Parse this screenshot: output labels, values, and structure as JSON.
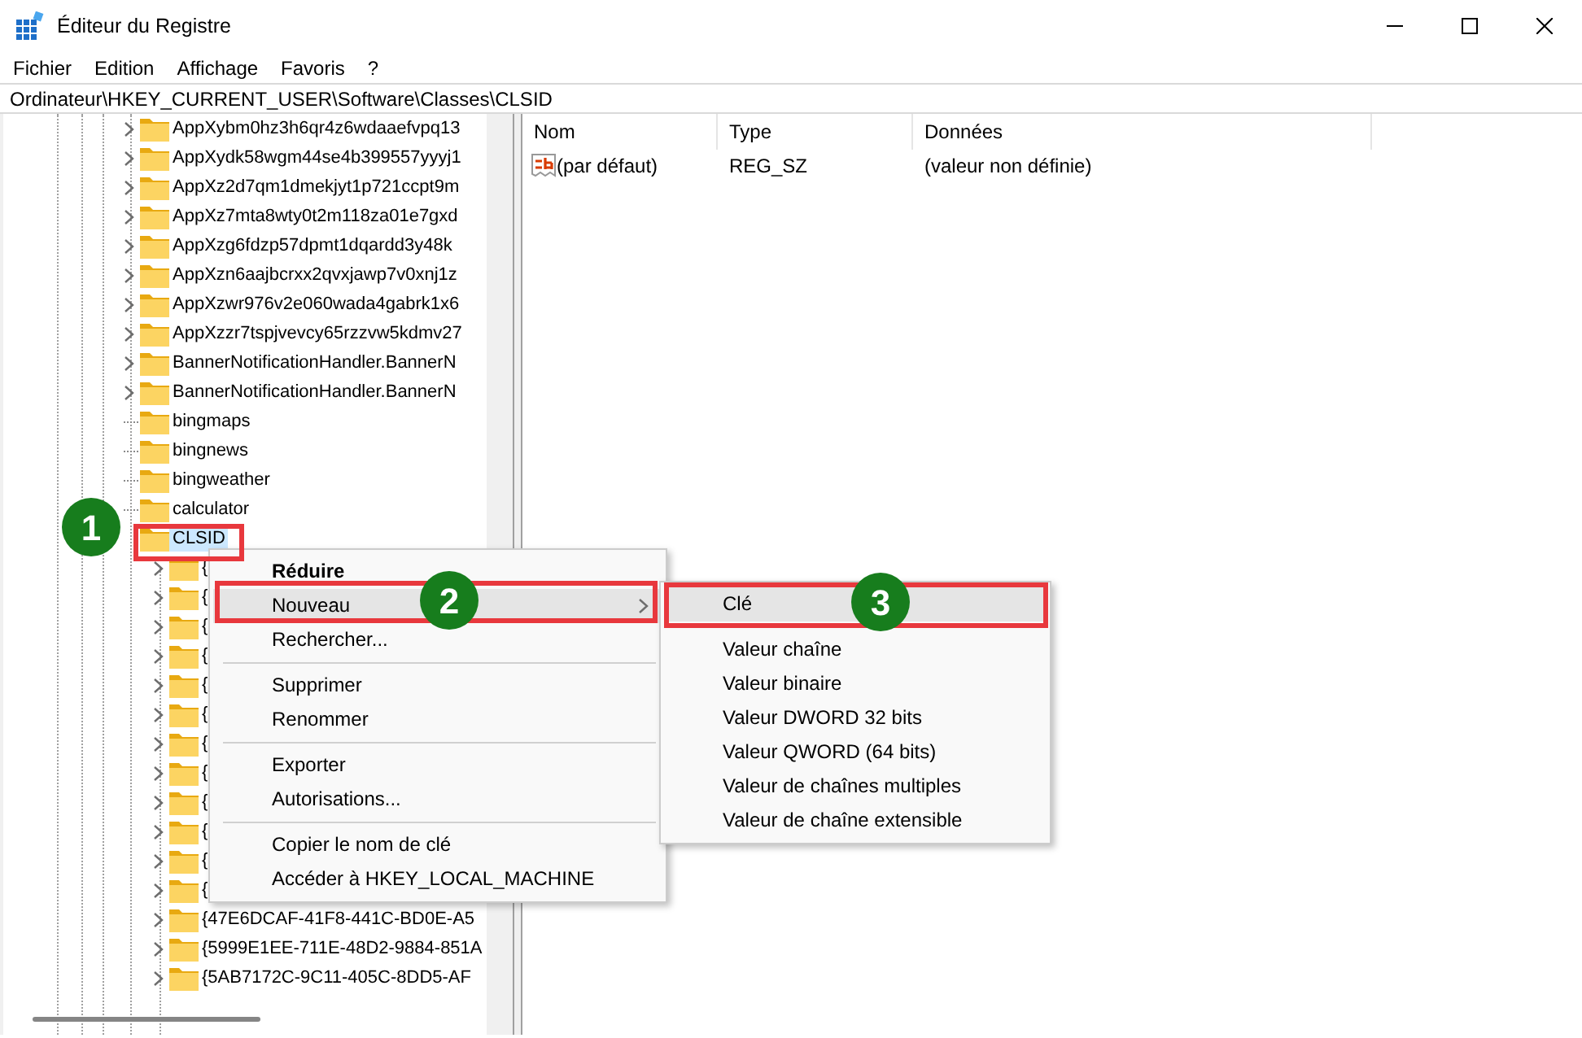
{
  "window": {
    "title": "Éditeur du Registre"
  },
  "menu_bar": [
    "Fichier",
    "Edition",
    "Affichage",
    "Favoris",
    "?"
  ],
  "address_bar": "Ordinateur\\HKEY_CURRENT_USER\\Software\\Classes\\CLSID",
  "tree": {
    "items": [
      {
        "label": "AppXybm0hz3h6qr4z6wdaaefvpq13",
        "expandable": true,
        "selected": false
      },
      {
        "label": "AppXydk58wgm44se4b399557yyyj1",
        "expandable": true,
        "selected": false
      },
      {
        "label": "AppXz2d7qm1dmekjyt1p721ccpt9m",
        "expandable": true,
        "selected": false
      },
      {
        "label": "AppXz7mta8wty0t2m118za01e7gxd",
        "expandable": true,
        "selected": false
      },
      {
        "label": "AppXzg6fdzp57dpmt1dqardd3y48k",
        "expandable": true,
        "selected": false
      },
      {
        "label": "AppXzn6aajbcrxx2qvxjawp7v0xnj1z",
        "expandable": true,
        "selected": false
      },
      {
        "label": "AppXzwr976v2e060wada4gabrk1x6",
        "expandable": true,
        "selected": false
      },
      {
        "label": "AppXzzr7tspjvevcy65rzzvw5kdmv27",
        "expandable": true,
        "selected": false
      },
      {
        "label": "BannerNotificationHandler.BannerN",
        "expandable": true,
        "selected": false
      },
      {
        "label": "BannerNotificationHandler.BannerN",
        "expandable": true,
        "selected": false
      },
      {
        "label": "bingmaps",
        "expandable": false,
        "selected": false
      },
      {
        "label": "bingnews",
        "expandable": false,
        "selected": false
      },
      {
        "label": "bingweather",
        "expandable": false,
        "selected": false
      },
      {
        "label": "calculator",
        "expandable": false,
        "selected": false
      },
      {
        "label": "CLSID",
        "selected": true,
        "children": [
          {
            "label": "{",
            "expandable": true,
            "selected": false
          },
          {
            "label": "{",
            "expandable": true,
            "selected": false
          },
          {
            "label": "{",
            "expandable": true,
            "selected": false
          },
          {
            "label": "{",
            "expandable": true,
            "selected": false
          },
          {
            "label": "{",
            "expandable": true,
            "selected": false
          },
          {
            "label": "{",
            "expandable": true,
            "selected": false
          },
          {
            "label": "{",
            "expandable": true,
            "selected": false
          },
          {
            "label": "{",
            "expandable": true,
            "selected": false
          },
          {
            "label": "{",
            "expandable": true,
            "selected": false
          },
          {
            "label": "{",
            "expandable": true,
            "selected": false
          },
          {
            "label": "{",
            "expandable": true,
            "selected": false
          },
          {
            "label": "{",
            "expandable": true,
            "selected": false
          },
          {
            "label": "{47E6DCAF-41F8-441C-BD0E-A5",
            "expandable": true,
            "selected": false
          },
          {
            "label": "{5999E1EE-711E-48D2-9884-851A",
            "expandable": true,
            "selected": false
          },
          {
            "label": "{5AB7172C-9C11-405C-8DD5-AF",
            "expandable": true,
            "selected": false
          }
        ]
      }
    ]
  },
  "values": {
    "columns": [
      "Nom",
      "Type",
      "Données"
    ],
    "rows": [
      {
        "name": "(par défaut)",
        "type": "REG_SZ",
        "data": "(valeur non définie)"
      }
    ]
  },
  "context_menu": {
    "items": [
      {
        "kind": "item",
        "label": "Réduire",
        "bold": true,
        "submenu": false,
        "selected": false
      },
      {
        "kind": "item",
        "label": "Nouveau",
        "bold": false,
        "submenu": true,
        "selected": true
      },
      {
        "kind": "item",
        "label": "Rechercher...",
        "bold": false,
        "submenu": false,
        "selected": false
      },
      {
        "kind": "separator"
      },
      {
        "kind": "item",
        "label": "Supprimer",
        "bold": false,
        "submenu": false,
        "selected": false
      },
      {
        "kind": "item",
        "label": "Renommer",
        "bold": false,
        "submenu": false,
        "selected": false
      },
      {
        "kind": "separator"
      },
      {
        "kind": "item",
        "label": "Exporter",
        "bold": false,
        "submenu": false,
        "selected": false
      },
      {
        "kind": "item",
        "label": "Autorisations...",
        "bold": false,
        "submenu": false,
        "selected": false
      },
      {
        "kind": "separator"
      },
      {
        "kind": "item",
        "label": "Copier le nom de clé",
        "bold": false,
        "submenu": false,
        "selected": false
      },
      {
        "kind": "item",
        "label": "Accéder à HKEY_LOCAL_MACHINE",
        "bold": false,
        "submenu": false,
        "selected": false
      }
    ]
  },
  "submenu": {
    "items": [
      {
        "kind": "item",
        "label": "Clé",
        "selected": true
      },
      {
        "kind": "separator"
      },
      {
        "kind": "item",
        "label": "Valeur chaîne",
        "selected": false
      },
      {
        "kind": "item",
        "label": "Valeur binaire",
        "selected": false
      },
      {
        "kind": "item",
        "label": "Valeur DWORD 32 bits",
        "selected": false
      },
      {
        "kind": "item",
        "label": "Valeur QWORD (64 bits)",
        "selected": false
      },
      {
        "kind": "item",
        "label": "Valeur de chaînes multiples",
        "selected": false
      },
      {
        "kind": "item",
        "label": "Valeur de chaîne extensible",
        "selected": false
      }
    ]
  },
  "step_badges": [
    "1",
    "2",
    "3"
  ]
}
